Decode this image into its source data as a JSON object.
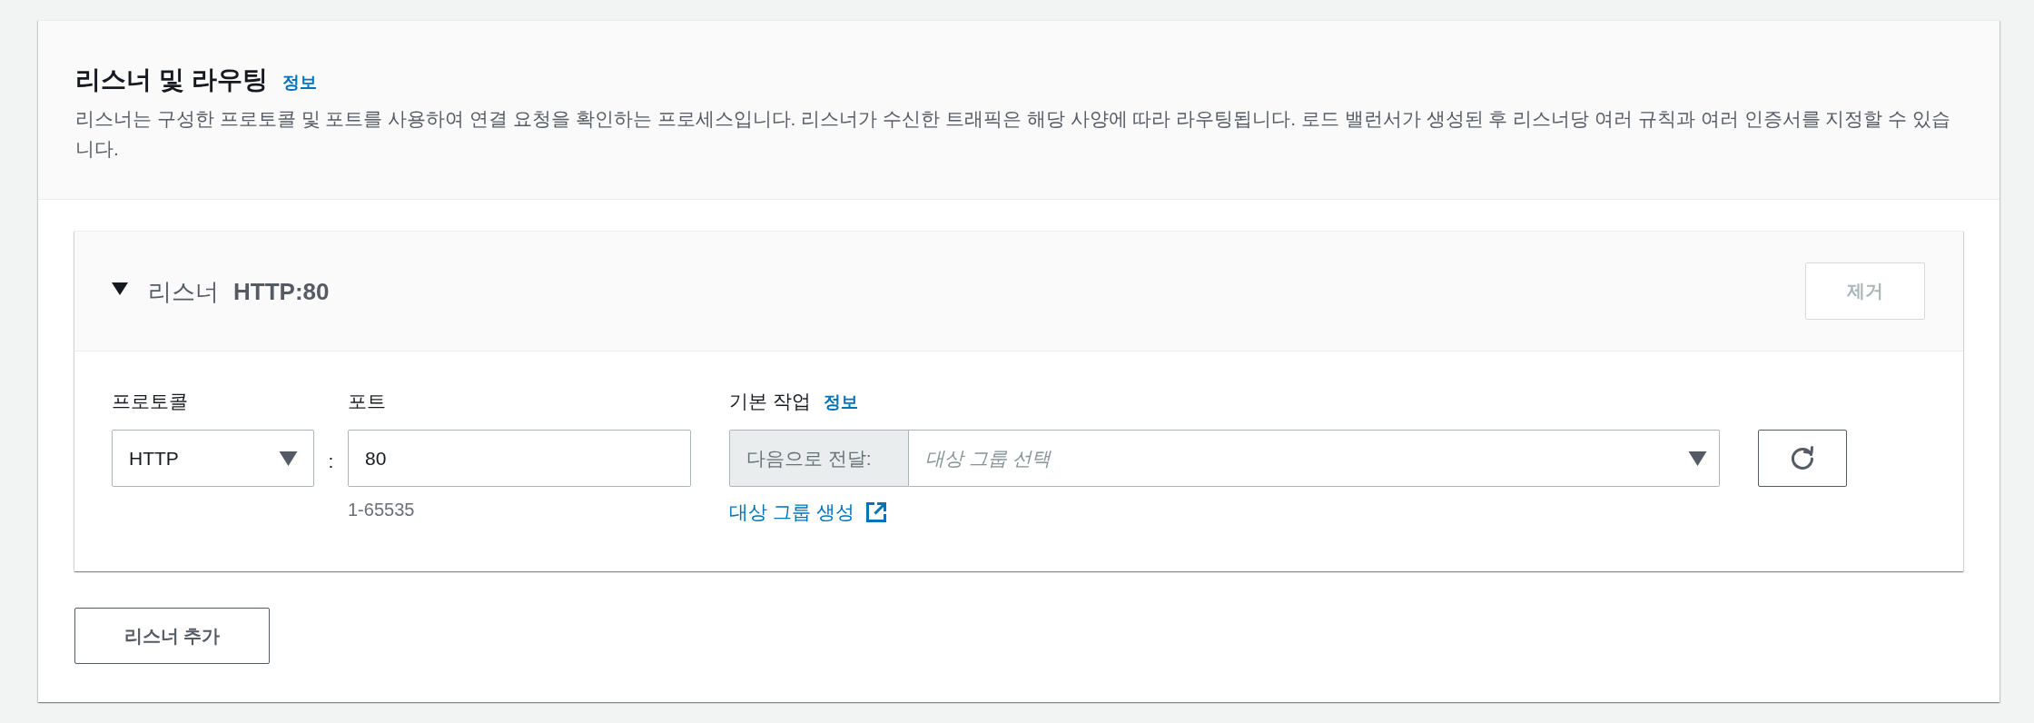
{
  "section": {
    "title": "리스너 및 라우팅",
    "info_link": "정보",
    "description": "리스너는 구성한 프로토콜 및 포트를 사용하여 연결 요청을 확인하는 프로세스입니다. 리스너가 수신한 트래픽은 해당 사양에 따라 라우팅됩니다. 로드 밸런서가 생성된 후 리스너당 여러 규칙과 여러 인증서를 지정할 수 있습니다."
  },
  "listeners": [
    {
      "expanded": true,
      "label": "리스너",
      "name": "HTTP:80",
      "remove_button": {
        "label": "제거",
        "disabled": true
      },
      "protocol": {
        "label": "프로토콜",
        "value": "HTTP"
      },
      "separator": ":",
      "port": {
        "label": "포트",
        "value": "80",
        "hint": "1-65535"
      },
      "default_action": {
        "label": "기본 작업",
        "info_link": "정보",
        "prefix": "다음으로 전달:",
        "placeholder": "대상 그룹 선택",
        "create_link": "대상 그룹 생성"
      }
    }
  ],
  "add_button": {
    "label": "리스너 추가"
  }
}
